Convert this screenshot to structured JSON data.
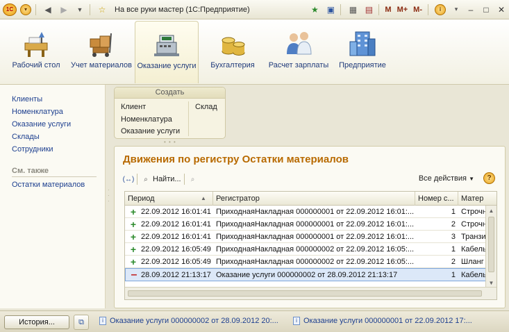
{
  "window": {
    "title": "На все руки мастер  (1С:Предприятие)",
    "m_buttons": [
      "M",
      "M+",
      "M-"
    ]
  },
  "sections": [
    {
      "label": "Рабочий стол",
      "icon": "desk-icon"
    },
    {
      "label": "Учет материалов",
      "icon": "boxes-cart-icon"
    },
    {
      "label": "Оказание услуги",
      "icon": "cash-register-icon",
      "active": true
    },
    {
      "label": "Бухгалтерия",
      "icon": "coins-icon"
    },
    {
      "label": "Расчет зарплаты",
      "icon": "people-icon"
    },
    {
      "label": "Предприятие",
      "icon": "building-icon"
    }
  ],
  "nav": {
    "items": [
      "Клиенты",
      "Номенклатура",
      "Оказание услуги",
      "Склады",
      "Сотрудники"
    ],
    "see_also_header": "См. также",
    "see_also": [
      "Остатки материалов"
    ]
  },
  "create": {
    "header": "Создать",
    "left": [
      "Клиент",
      "Номенклатура",
      "Оказание услуги"
    ],
    "right": [
      "Склад"
    ]
  },
  "form": {
    "title": "Движения по регистру Остатки материалов",
    "find_label": "Найти...",
    "all_actions_label": "Все действия",
    "columns": [
      "Период",
      "Регистратор",
      "Номер с...",
      "Матер"
    ],
    "rows": [
      {
        "type": "+",
        "period": "22.09.2012 16:01:41",
        "registrar": "ПриходнаяНакладная 000000001 от 22.09.2012 16:01:...",
        "num": "1",
        "material": "Строчн"
      },
      {
        "type": "+",
        "period": "22.09.2012 16:01:41",
        "registrar": "ПриходнаяНакладная 000000001 от 22.09.2012 16:01:...",
        "num": "2",
        "material": "Строчн"
      },
      {
        "type": "+",
        "period": "22.09.2012 16:01:41",
        "registrar": "ПриходнаяНакладная 000000001 от 22.09.2012 16:01:...",
        "num": "3",
        "material": "Транзи"
      },
      {
        "type": "+",
        "period": "22.09.2012 16:05:49",
        "registrar": "ПриходнаяНакладная 000000002 от 22.09.2012 16:05:...",
        "num": "1",
        "material": "Кабель"
      },
      {
        "type": "+",
        "period": "22.09.2012 16:05:49",
        "registrar": "ПриходнаяНакладная 000000002 от 22.09.2012 16:05:...",
        "num": "2",
        "material": "Шланг"
      },
      {
        "type": "-",
        "period": "28.09.2012 21:13:17",
        "registrar": "Оказание услуги 000000002 от 28.09.2012 21:13:17",
        "num": "1",
        "material": "Кабель",
        "selected": true
      }
    ]
  },
  "bottombar": {
    "history_label": "История...",
    "open_windows": [
      "Оказание услуги 000000002 от 28.09.2012 20:...",
      "Оказание услуги 000000001 от 22.09.2012 17:..."
    ]
  },
  "colors": {
    "accent_title": "#b86a00",
    "link": "#1d3f8f",
    "selection": "#dce8f8"
  }
}
